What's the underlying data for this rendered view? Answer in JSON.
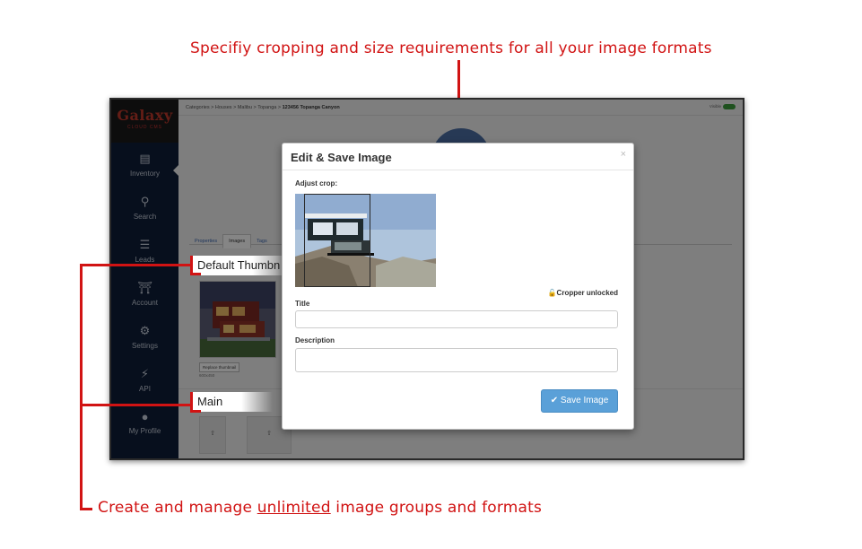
{
  "annotations": {
    "top": "Specifiy cropping and size requirements for all your image formats",
    "bottom_before": "Create and manage ",
    "bottom_underlined": "unlimited",
    "bottom_after": " image groups and formats",
    "color": "#d11313"
  },
  "app": {
    "logo": {
      "name": "Galaxy",
      "tagline": "CLOUD CMS"
    },
    "sidebar": {
      "items": [
        {
          "label": "Inventory",
          "icon": "inventory-icon"
        },
        {
          "label": "Search",
          "icon": "search-icon"
        },
        {
          "label": "Leads",
          "icon": "list-icon"
        },
        {
          "label": "Account",
          "icon": "bank-icon"
        },
        {
          "label": "Settings",
          "icon": "gears-icon"
        },
        {
          "label": "API",
          "icon": "plug-icon"
        },
        {
          "label": "My Profile",
          "icon": "user-icon"
        }
      ]
    },
    "breadcrumb": [
      "Categories",
      "Houses",
      "Malibu",
      "Topanga"
    ],
    "breadcrumb_current": "123456 Topanga Canyon",
    "visible_toggle": "Visible",
    "tabs": [
      "Properties",
      "Images",
      "Tags"
    ],
    "default_thumbnail_label": "Default Thumbn",
    "replace_button": "Replace thumbnail",
    "thumb_dims": "600x450",
    "main_label": "Main",
    "upload_icon": "upload-icon"
  },
  "modal": {
    "title": "Edit & Save Image",
    "close": "×",
    "adjust_crop_label": "Adjust crop:",
    "lock_status": "Cropper unlocked",
    "title_label": "Title",
    "title_value": "",
    "description_label": "Description",
    "description_value": "",
    "save_button": "Save Image",
    "save_color": "#5aa0d8"
  }
}
